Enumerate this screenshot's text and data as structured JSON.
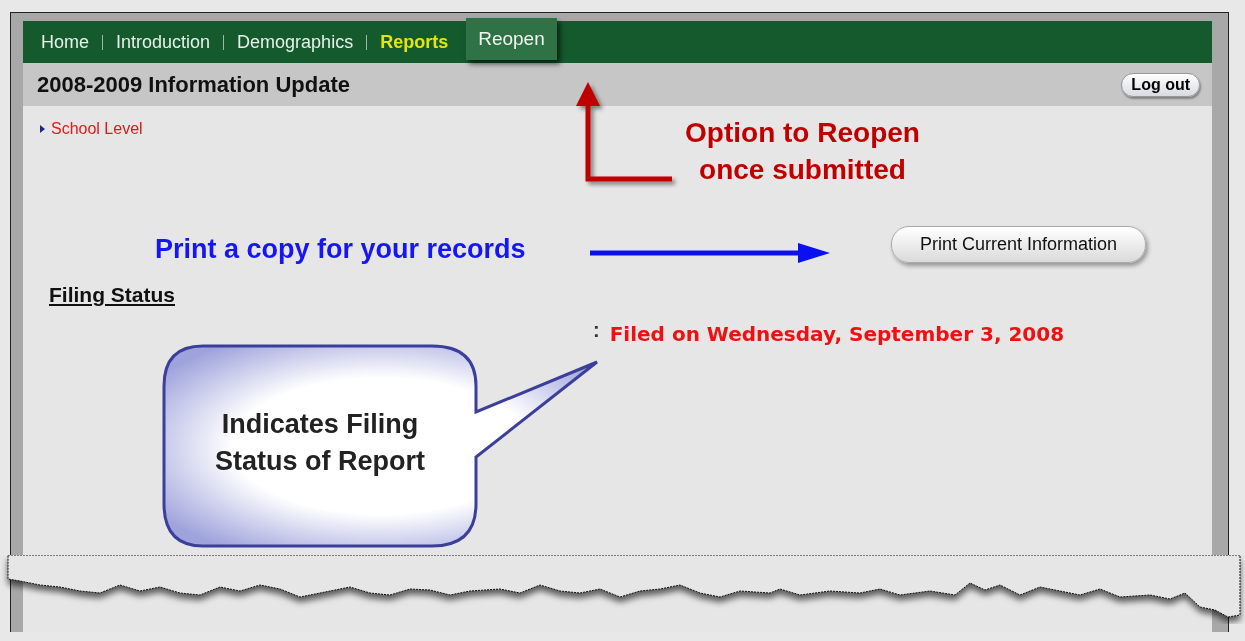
{
  "nav": {
    "items": [
      {
        "label": "Home",
        "kind": "link",
        "selected": false
      },
      {
        "label": "Introduction",
        "kind": "link",
        "selected": false
      },
      {
        "label": "Demographics",
        "kind": "link",
        "selected": false
      },
      {
        "label": "Reports",
        "kind": "link",
        "selected": true
      },
      {
        "label": "Reopen",
        "kind": "raised",
        "selected": false
      }
    ]
  },
  "header": {
    "title": "2008-2009 Information Update",
    "logout": "Log out"
  },
  "sidebar": {
    "items": [
      {
        "label": "School Level"
      }
    ]
  },
  "print_button": "Print Current Information",
  "filing": {
    "heading": "Filing Status",
    "separator": ":",
    "status": "Filed on Wednesday, September 3, 2008"
  },
  "annotations": [
    {
      "kind": "elbow-arrow",
      "text": "Option to Reopen\nonce submitted"
    },
    {
      "kind": "arrow",
      "text": "Print a copy for your records"
    },
    {
      "kind": "callout",
      "text": "Indicates Filing\nStatus of Report"
    }
  ]
}
